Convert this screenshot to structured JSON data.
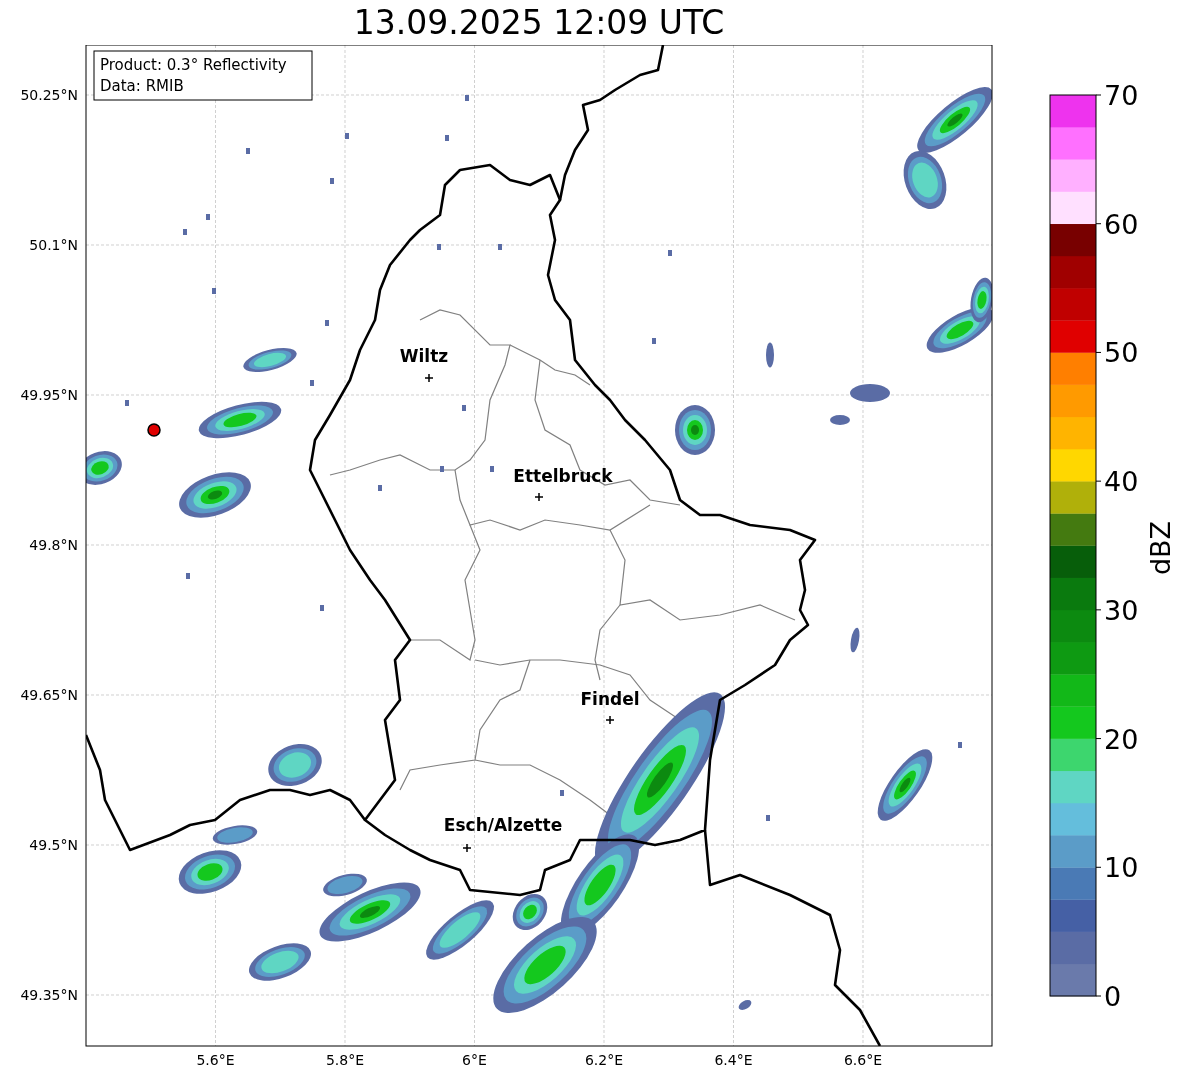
{
  "title": "13.09.2025 12:09 UTC",
  "info_box": {
    "lines": [
      "Product: 0.3° Reflectivity",
      "Data: RMIB"
    ]
  },
  "y_axis": {
    "ticks": [
      "50.25°N",
      "50.1°N",
      "49.95°N",
      "49.8°N",
      "49.65°N",
      "49.5°N",
      "49.35°N"
    ]
  },
  "x_axis": {
    "ticks": [
      "5.6°E",
      "5.8°E",
      "6°E",
      "6.2°E",
      "6.4°E",
      "6.6°E"
    ]
  },
  "cities": [
    {
      "name": "Wiltz"
    },
    {
      "name": "Ettelbruck"
    },
    {
      "name": "Findel"
    },
    {
      "name": "Esch/Alzette"
    }
  ],
  "colorbar": {
    "label": "dBZ",
    "ticks": [
      "70",
      "60",
      "50",
      "40",
      "30",
      "20",
      "10",
      "0"
    ],
    "segments": [
      {
        "color": "#6a7aab"
      },
      {
        "color": "#5a6ca5"
      },
      {
        "color": "#4560a5"
      },
      {
        "color": "#4a7ab5"
      },
      {
        "color": "#5b9cc8"
      },
      {
        "color": "#64bedc"
      },
      {
        "color": "#5fd6c3"
      },
      {
        "color": "#3dd66e"
      },
      {
        "color": "#14c81e"
      },
      {
        "color": "#12b818"
      },
      {
        "color": "#0e9a12"
      },
      {
        "color": "#0c8a10"
      },
      {
        "color": "#0a7a0e"
      },
      {
        "color": "#075e0a"
      },
      {
        "color": "#447a10"
      },
      {
        "color": "#b0b00a"
      },
      {
        "color": "#ffd700"
      },
      {
        "color": "#ffb400"
      },
      {
        "color": "#ff9a00"
      },
      {
        "color": "#ff7f00"
      },
      {
        "color": "#e00000"
      },
      {
        "color": "#c00000"
      },
      {
        "color": "#a00000"
      },
      {
        "color": "#780000"
      },
      {
        "color": "#ffe0ff"
      },
      {
        "color": "#ffb0ff"
      },
      {
        "color": "#ff70ff"
      },
      {
        "color": "#ee33ee"
      }
    ]
  }
}
